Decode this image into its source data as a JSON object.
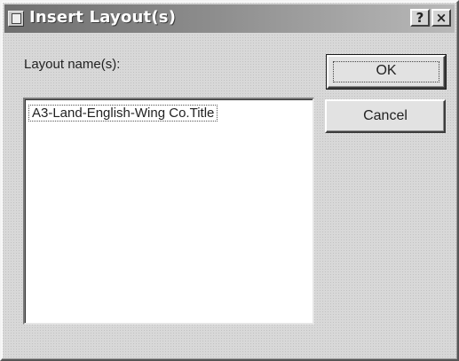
{
  "window": {
    "title": "Insert Layout(s)",
    "help_button": "?",
    "close_button": "×",
    "icon": "app-icon"
  },
  "form": {
    "label": "Layout name(s):",
    "items": [
      "A3-Land-English-Wing Co.Title"
    ]
  },
  "buttons": {
    "ok": "OK",
    "cancel": "Cancel"
  }
}
